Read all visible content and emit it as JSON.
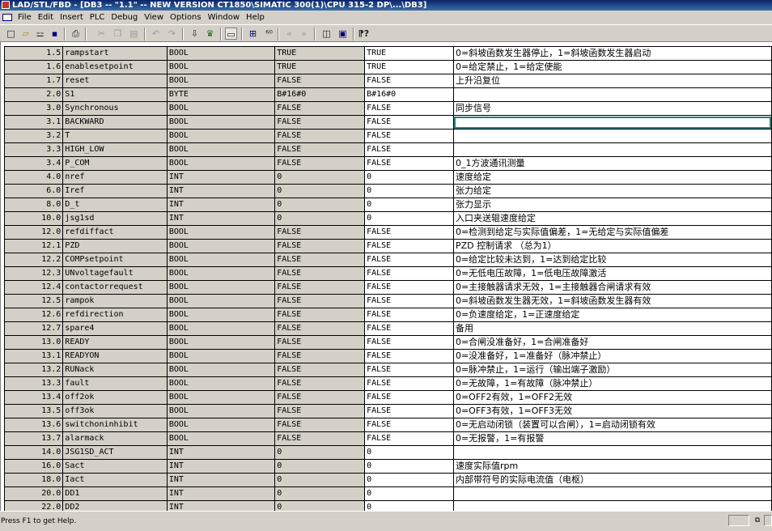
{
  "titlebar": {
    "title": "LAD/STL/FBD - [DB3 -- \"1.1\" -- NEW VERSION CT1850\\SIMATIC 300(1)\\CPU 315-2 DP\\...\\DB3]"
  },
  "menubar": {
    "items": [
      "File",
      "Edit",
      "Insert",
      "PLC",
      "Debug",
      "View",
      "Options",
      "Window",
      "Help"
    ]
  },
  "toolbar": {
    "icons": [
      "new-icon",
      "open-icon",
      "accessible-nodes-icon",
      "save-icon",
      "print-icon",
      "cut-icon",
      "copy-icon",
      "paste-icon",
      "undo-icon",
      "redo-icon",
      "download-icon",
      "monitor-icon",
      "overview-icon",
      "compare-icon",
      "goto-icon",
      "prev-icon",
      "next-icon",
      "declaration-view-icon",
      "data-view-icon",
      "help-icon"
    ]
  },
  "table": {
    "rows": [
      {
        "addr": "1.5",
        "name": "rampstart",
        "type": "BOOL",
        "init": "TRUE",
        "act": "TRUE",
        "cmt": "0=斜坡函数发生器停止，1=斜坡函数发生器启动"
      },
      {
        "addr": "1.6",
        "name": "enablesetpoint",
        "type": "BOOL",
        "init": "TRUE",
        "act": "TRUE",
        "cmt": "0=给定禁止，1=给定使能"
      },
      {
        "addr": "1.7",
        "name": "reset",
        "type": "BOOL",
        "init": "FALSE",
        "act": "FALSE",
        "cmt": "上升沿复位"
      },
      {
        "addr": "2.0",
        "name": "S1",
        "type": "BYTE",
        "init": "B#16#0",
        "act": "B#16#0",
        "cmt": ""
      },
      {
        "addr": "3.0",
        "name": "Synchronous",
        "type": "BOOL",
        "init": "FALSE",
        "act": "FALSE",
        "cmt": "同步信号"
      },
      {
        "addr": "3.1",
        "name": "BACKWARD",
        "type": "BOOL",
        "init": "FALSE",
        "act": "FALSE",
        "cmt": ""
      },
      {
        "addr": "3.2",
        "name": "T",
        "type": "BOOL",
        "init": "FALSE",
        "act": "FALSE",
        "cmt": ""
      },
      {
        "addr": "3.3",
        "name": "HIGH_LOW",
        "type": "BOOL",
        "init": "FALSE",
        "act": "FALSE",
        "cmt": ""
      },
      {
        "addr": "3.4",
        "name": "P_COM",
        "type": "BOOL",
        "init": "FALSE",
        "act": "FALSE",
        "cmt": "0_1方波通讯测量"
      },
      {
        "addr": "4.0",
        "name": "nref",
        "type": "INT",
        "init": "0",
        "act": "0",
        "cmt": "速度给定"
      },
      {
        "addr": "6.0",
        "name": "Iref",
        "type": "INT",
        "init": "0",
        "act": "0",
        "cmt": "张力给定"
      },
      {
        "addr": "8.0",
        "name": "D_t",
        "type": "INT",
        "init": "0",
        "act": "0",
        "cmt": "张力显示"
      },
      {
        "addr": "10.0",
        "name": "jsg1sd",
        "type": "INT",
        "init": "0",
        "act": "0",
        "cmt": "入口夹送辊速度给定"
      },
      {
        "addr": "12.0",
        "name": "refdiffact",
        "type": "BOOL",
        "init": "FALSE",
        "act": "FALSE",
        "cmt": "0=检测到给定与实际值偏差，1=无给定与实际值偏差"
      },
      {
        "addr": "12.1",
        "name": "PZD",
        "type": "BOOL",
        "init": "FALSE",
        "act": "FALSE",
        "cmt": "PZD 控制请求 （总为1）"
      },
      {
        "addr": "12.2",
        "name": "COMPsetpoint",
        "type": "BOOL",
        "init": "FALSE",
        "act": "FALSE",
        "cmt": "0=给定比较未达到，1=达到给定比较"
      },
      {
        "addr": "12.3",
        "name": "UNvoltagefault",
        "type": "BOOL",
        "init": "FALSE",
        "act": "FALSE",
        "cmt": "0=无低电压故障，1=低电压故障激活"
      },
      {
        "addr": "12.4",
        "name": "contactorrequest",
        "type": "BOOL",
        "init": "FALSE",
        "act": "FALSE",
        "cmt": "0=主接触器请求无效，1=主接触器合闸请求有效"
      },
      {
        "addr": "12.5",
        "name": "rampok",
        "type": "BOOL",
        "init": "FALSE",
        "act": "FALSE",
        "cmt": "0=斜坡函数发生器无效，1=斜坡函数发生器有效"
      },
      {
        "addr": "12.6",
        "name": "refdirection",
        "type": "BOOL",
        "init": "FALSE",
        "act": "FALSE",
        "cmt": "0=负速度给定，1=正速度给定"
      },
      {
        "addr": "12.7",
        "name": "spare4",
        "type": "BOOL",
        "init": "FALSE",
        "act": "FALSE",
        "cmt": "备用"
      },
      {
        "addr": "13.0",
        "name": "READY",
        "type": "BOOL",
        "init": "FALSE",
        "act": "FALSE",
        "cmt": "0=合闸没准备好，1=合闸准备好"
      },
      {
        "addr": "13.1",
        "name": "READYON",
        "type": "BOOL",
        "init": "FALSE",
        "act": "FALSE",
        "cmt": "0=没准备好，1=准备好（脉冲禁止）"
      },
      {
        "addr": "13.2",
        "name": "RUNack",
        "type": "BOOL",
        "init": "FALSE",
        "act": "FALSE",
        "cmt": "0=脉冲禁止，1=运行（输出端子激励）"
      },
      {
        "addr": "13.3",
        "name": "fault",
        "type": "BOOL",
        "init": "FALSE",
        "act": "FALSE",
        "cmt": "0=无故障，1=有故障（脉冲禁止）"
      },
      {
        "addr": "13.4",
        "name": "off2ok",
        "type": "BOOL",
        "init": "FALSE",
        "act": "FALSE",
        "cmt": "0=OFF2有效，1=OFF2无效"
      },
      {
        "addr": "13.5",
        "name": "off3ok",
        "type": "BOOL",
        "init": "FALSE",
        "act": "FALSE",
        "cmt": "0=OFF3有效，1=OFF3无效"
      },
      {
        "addr": "13.6",
        "name": "switchoninhibit",
        "type": "BOOL",
        "init": "FALSE",
        "act": "FALSE",
        "cmt": "0=无启动闭锁（装置可以合闸），1=启动闭锁有效"
      },
      {
        "addr": "13.7",
        "name": "alarmack",
        "type": "BOOL",
        "init": "FALSE",
        "act": "FALSE",
        "cmt": "0=无报警，1=有报警"
      },
      {
        "addr": "14.0",
        "name": "JSG1SD_ACT",
        "type": "INT",
        "init": "0",
        "act": "0",
        "cmt": ""
      },
      {
        "addr": "16.0",
        "name": "Sact",
        "type": "INT",
        "init": "0",
        "act": "0",
        "cmt": "速度实际值rpm"
      },
      {
        "addr": "18.0",
        "name": "Iact",
        "type": "INT",
        "init": "0",
        "act": "0",
        "cmt": "内部带符号的实际电流值（电枢）"
      },
      {
        "addr": "20.0",
        "name": "DD1",
        "type": "INT",
        "init": "0",
        "act": "0",
        "cmt": ""
      },
      {
        "addr": "22.0",
        "name": "DD2",
        "type": "INT",
        "init": "0",
        "act": "0",
        "cmt": ""
      }
    ],
    "focused_row": 5
  },
  "status": {
    "text": "Press F1 to get Help."
  }
}
